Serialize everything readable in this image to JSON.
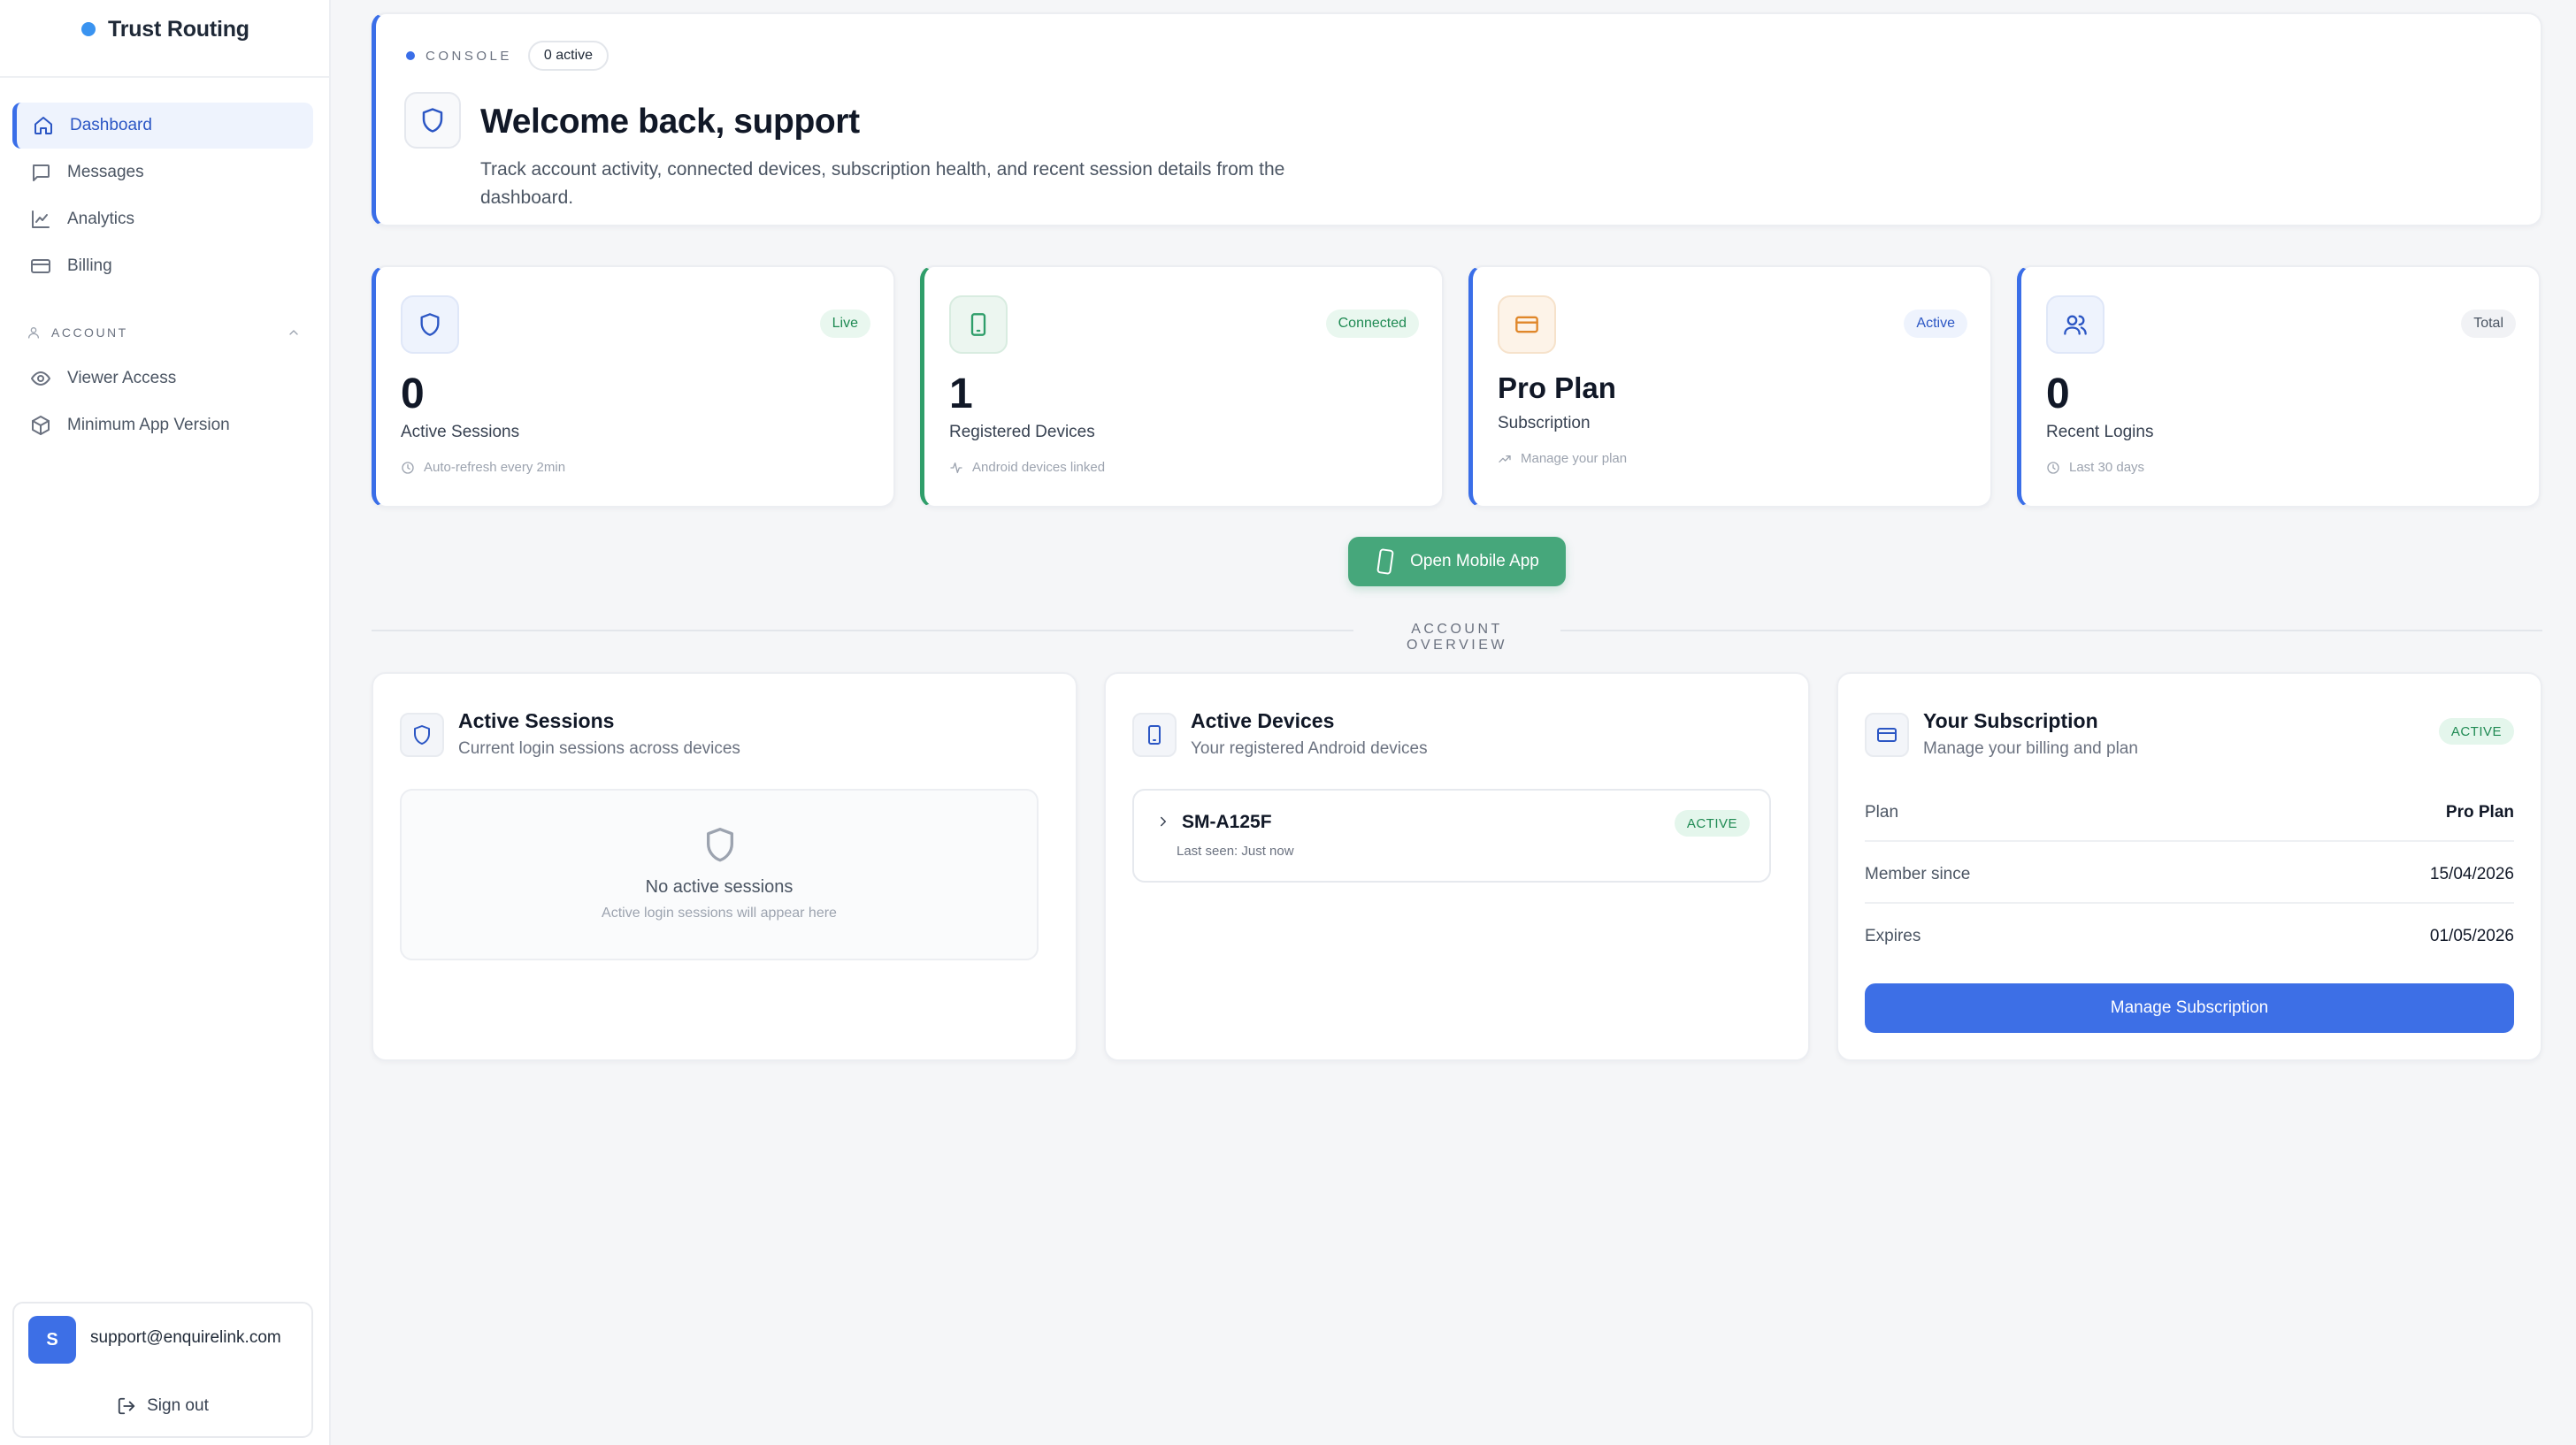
{
  "brand": {
    "name": "Trust Routing",
    "accent": "#3a93f0"
  },
  "sidebar": {
    "nav": [
      {
        "label": "Dashboard",
        "icon": "home-icon",
        "active": true
      },
      {
        "label": "Messages",
        "icon": "message-icon"
      },
      {
        "label": "Analytics",
        "icon": "chart-line-icon"
      },
      {
        "label": "Billing",
        "icon": "credit-card-icon"
      }
    ],
    "account_section": {
      "title": "ACCOUNT",
      "items": [
        {
          "label": "Viewer Access",
          "icon": "eye-icon"
        },
        {
          "label": "Minimum App Version",
          "icon": "package-icon"
        }
      ]
    },
    "user": {
      "avatar_letter": "S",
      "email": "support@enquirelink.com",
      "signout_label": "Sign out"
    }
  },
  "hero": {
    "console_label": "CONSOLE",
    "active_pill": "0 active",
    "title": "Welcome back, support",
    "description": "Track account activity, connected devices, subscription health, and recent session details from the dashboard."
  },
  "stats": [
    {
      "value": "0",
      "label": "Active Sessions",
      "badge": "Live",
      "sub": "Auto-refresh every 2min",
      "icon": "shield-icon",
      "color": "#3a6ee8"
    },
    {
      "value": "1",
      "label": "Registered Devices",
      "badge": "Connected",
      "sub": "Android devices linked",
      "icon": "smartphone-icon",
      "color": "#2f9e6a"
    },
    {
      "value": "Pro Plan",
      "label": "Subscription",
      "badge": "Active",
      "sub": "Manage your plan",
      "icon": "credit-card-icon",
      "color": "#e0872a"
    },
    {
      "value": "0",
      "label": "Recent Logins",
      "badge": "Total",
      "sub": "Last 30 days",
      "icon": "users-icon",
      "color": "#3a6ee8"
    }
  ],
  "open_app_button": "Open Mobile App",
  "overview_label": "ACCOUNT OVERVIEW",
  "sessions_panel": {
    "title": "Active Sessions",
    "subtitle": "Current login sessions across devices",
    "empty_title": "No active sessions",
    "empty_sub": "Active login sessions will appear here"
  },
  "devices_panel": {
    "title": "Active Devices",
    "subtitle": "Your registered Android devices",
    "devices": [
      {
        "name": "SM-A125F",
        "last_seen": "Last seen: Just now",
        "status": "ACTIVE"
      }
    ]
  },
  "subscription_panel": {
    "title": "Your Subscription",
    "subtitle": "Manage your billing and plan",
    "status": "ACTIVE",
    "rows": [
      {
        "label": "Plan",
        "value": "Pro Plan"
      },
      {
        "label": "Member since",
        "value": "15/04/2026"
      },
      {
        "label": "Expires",
        "value": "01/05/2026"
      }
    ],
    "button": "Manage Subscription"
  }
}
